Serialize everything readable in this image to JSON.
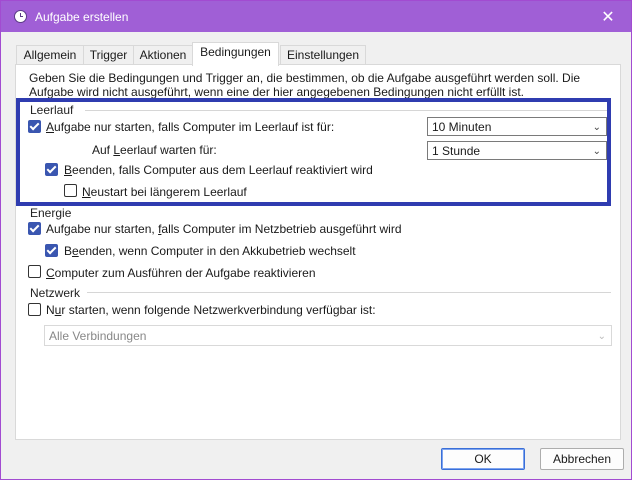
{
  "window": {
    "title": "Aufgabe erstellen"
  },
  "tabs": [
    "Allgemein",
    "Trigger",
    "Aktionen",
    "Bedingungen",
    "Einstellungen"
  ],
  "active_tab": "Bedingungen",
  "description": "Geben Sie die Bedingungen und Trigger an, die bestimmen, ob die Aufgabe ausgeführt werden soll. Die Aufgabe wird nicht ausgeführt, wenn eine der hier angegebenen Bedingungen nicht erfüllt ist.",
  "idle": {
    "group_label": "Leerlauf",
    "start_if_idle": {
      "pre": "",
      "u": "A",
      "post": "ufgabe nur starten, falls Computer im Leerlauf ist für:",
      "checked": true
    },
    "idle_duration": "10 Minuten",
    "wait_label": {
      "pre": "Auf ",
      "u": "L",
      "post": "eerlauf warten für:"
    },
    "wait_duration": "1 Stunde",
    "stop_if_active": {
      "pre": "",
      "u": "B",
      "post": "eenden, falls Computer aus dem Leerlauf reaktiviert wird",
      "checked": true
    },
    "restart_idle": {
      "pre": "",
      "u": "N",
      "post": "eustart bei längerem Leerlauf",
      "checked": false
    }
  },
  "power": {
    "group_label": "Energie",
    "start_on_ac": {
      "pre": "Aufgabe nur starten, ",
      "u": "f",
      "post": "alls Computer im Netzbetrieb ausgeführt wird",
      "checked": true
    },
    "stop_on_battery": {
      "pre": "B",
      "u": "e",
      "post": "enden, wenn Computer in den Akkubetrieb wechselt",
      "checked": true
    },
    "wake": {
      "pre": "",
      "u": "C",
      "post": "omputer zum Ausführen der Aufgabe reaktivieren",
      "checked": false
    }
  },
  "network": {
    "group_label": "Netzwerk",
    "start_if_network": {
      "pre": "N",
      "u": "u",
      "post": "r starten, wenn folgende Netzwerkverbindung verfügbar ist:",
      "checked": false
    },
    "connection": "Alle Verbindungen"
  },
  "buttons": {
    "ok": "OK",
    "cancel": "Abbrechen"
  }
}
